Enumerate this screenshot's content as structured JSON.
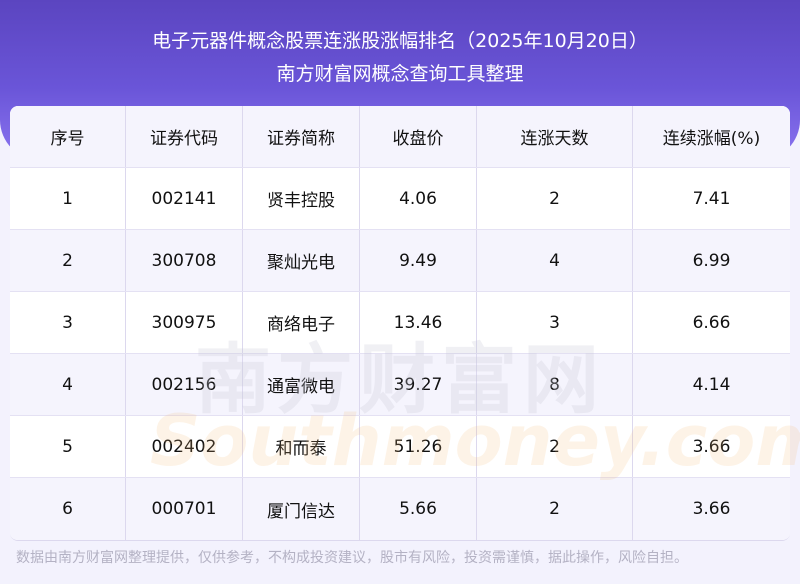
{
  "header": {
    "title": "电子元器件概念股票连涨股涨幅排名（2025年10月20日）",
    "subtitle": "南方财富网概念查询工具整理"
  },
  "table": {
    "columns": [
      "序号",
      "证券代码",
      "证券简称",
      "收盘价",
      "连涨天数",
      "连续涨幅(%)"
    ],
    "rows": [
      [
        "1",
        "002141",
        "贤丰控股",
        "4.06",
        "2",
        "7.41"
      ],
      [
        "2",
        "300708",
        "聚灿光电",
        "9.49",
        "4",
        "6.99"
      ],
      [
        "3",
        "300975",
        "商络电子",
        "13.46",
        "3",
        "6.66"
      ],
      [
        "4",
        "002156",
        "通富微电",
        "39.27",
        "8",
        "4.14"
      ],
      [
        "5",
        "002402",
        "和而泰",
        "51.26",
        "2",
        "3.66"
      ],
      [
        "6",
        "000701",
        "厦门信达",
        "5.66",
        "2",
        "3.66"
      ]
    ]
  },
  "watermark": {
    "cn": "南方财富网",
    "en": "southmoney.com"
  },
  "footer": "数据由南方财富网整理提供，仅供参考，不构成投资建议，股市有风险，投资需谨慎，据此操作，风险自担。"
}
